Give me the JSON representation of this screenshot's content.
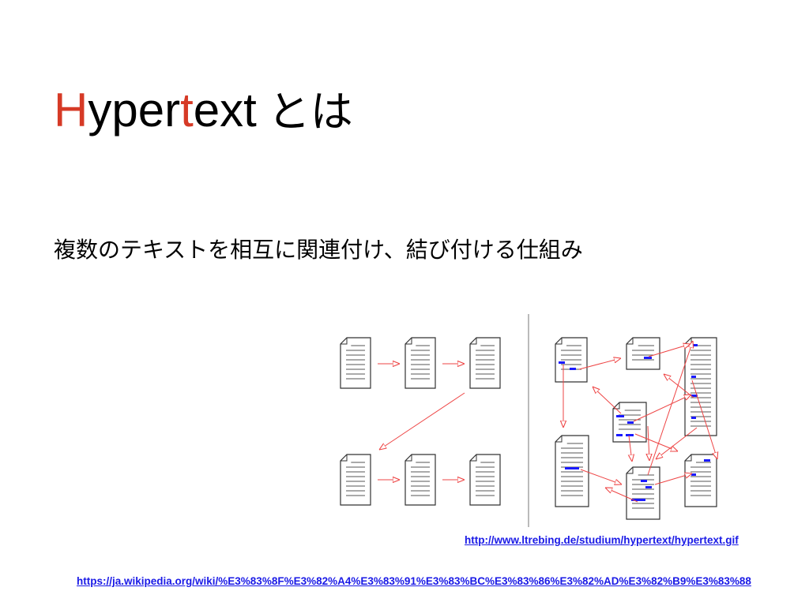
{
  "slide": {
    "title_parts": [
      "H",
      "yper",
      "t",
      "ext",
      "とは"
    ],
    "subtitle": "複数のテキストを相互に関連付け、結び付ける仕組み",
    "image_source_url": "http://www.ltrebing.de/studium/hypertext/hypertext.gif",
    "wiki_source_url": "https://ja.wikipedia.org/wiki/%E3%83%8F%E3%82%A4%E3%83%91%E3%83%BC%E3%83%86%E3%82%AD%E3%82%B9%E3%83%88"
  },
  "colors": {
    "title_accent": "#d63a26",
    "arrow": "#ee4444",
    "link_marker": "#1a1aff",
    "link_text": "#1a1ae6",
    "divider": "#bbbbbb"
  },
  "diagram": {
    "left_panel": "linear-text",
    "right_panel": "hypertext-network",
    "icon": "document-icon"
  }
}
